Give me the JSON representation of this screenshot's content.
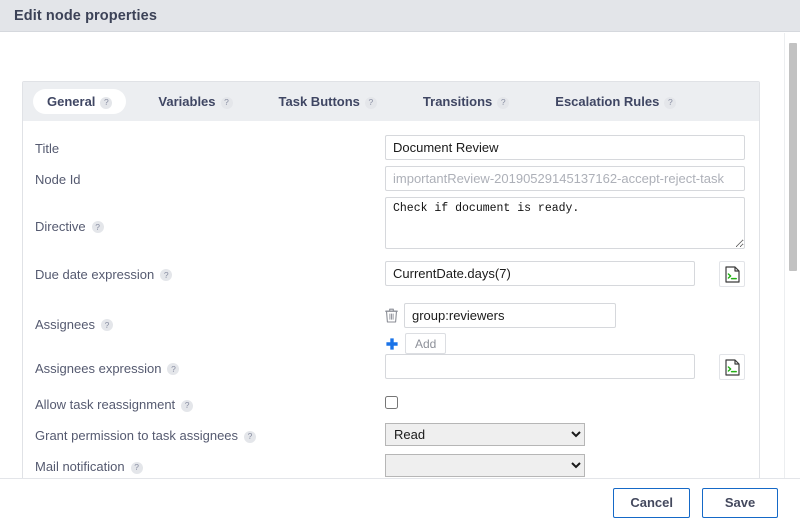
{
  "window": {
    "title": "Edit node properties"
  },
  "tabs": [
    {
      "label": "General",
      "help": "?",
      "active": true
    },
    {
      "label": "Variables",
      "help": "?",
      "active": false
    },
    {
      "label": "Task Buttons",
      "help": "?",
      "active": false
    },
    {
      "label": "Transitions",
      "help": "?",
      "active": false
    },
    {
      "label": "Escalation Rules",
      "help": "?",
      "active": false
    }
  ],
  "form": {
    "title": {
      "label": "Title",
      "value": "Document Review"
    },
    "node_id": {
      "label": "Node Id",
      "value": "importantReview-20190529145137162-accept-reject-task"
    },
    "directive": {
      "label": "Directive",
      "help": "?",
      "value": "Check if document is ready."
    },
    "due_date_expression": {
      "label": "Due date expression",
      "help": "?",
      "value": "CurrentDate.days(7)",
      "script_icon": "script-editor-icon"
    },
    "assignees": {
      "label": "Assignees",
      "help": "?",
      "value": "group:reviewers",
      "delete_icon": "trash-icon",
      "add_icon": "plus-icon",
      "add_label": "Add"
    },
    "assignees_expression": {
      "label": "Assignees expression",
      "help": "?",
      "value": "",
      "placeholder": "",
      "script_icon": "script-editor-icon"
    },
    "allow_task_reassignment": {
      "label": "Allow task reassignment",
      "help": "?",
      "checked": false
    },
    "grant_permission": {
      "label": "Grant permission to task assignees",
      "help": "?",
      "value": "Read",
      "options": [
        "Read"
      ]
    },
    "mail_notification": {
      "label": "Mail notification",
      "help": "?",
      "value": "",
      "options": [
        ""
      ]
    }
  },
  "footer": {
    "cancel_label": "Cancel",
    "save_label": "Save"
  },
  "colors": {
    "titlebar_bg": "#e3e5e9",
    "tabbar_bg": "#eceef1",
    "accent_blue": "#1569c7",
    "plus_blue": "#1a73e8",
    "script_green": "#22b014",
    "label_text": "#555a70"
  }
}
